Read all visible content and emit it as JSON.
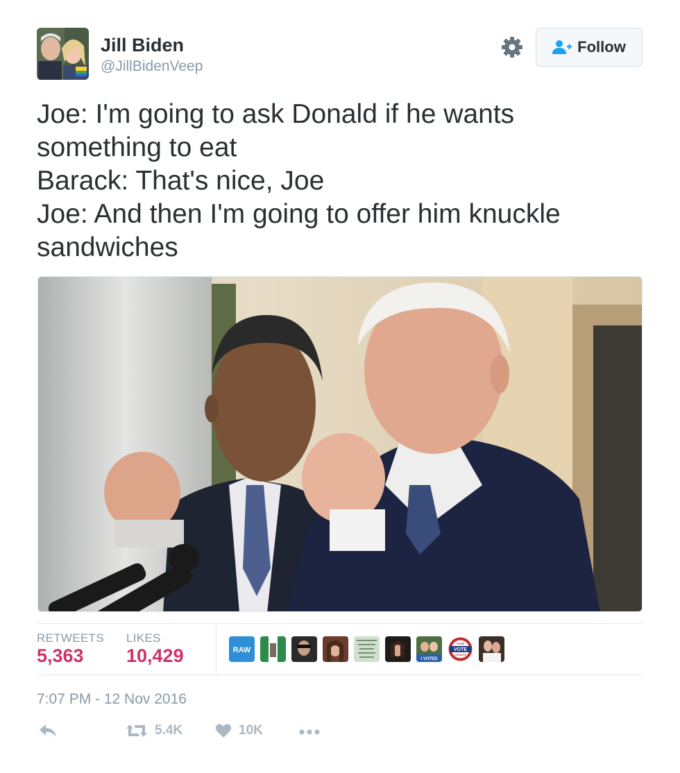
{
  "user": {
    "display_name": "Jill Biden",
    "handle": "@JillBidenVeep"
  },
  "header": {
    "follow_label": "Follow",
    "settings_icon": "gear-icon",
    "follow_icon": "add-user-icon"
  },
  "tweet": {
    "lines": [
      "Joe: I'm going to ask Donald if he wants",
      "something to eat",
      "Barack: That's nice, Joe",
      "Joe: And then I'm going to offer him knuckle",
      "sandwiches"
    ]
  },
  "stats": {
    "retweets_label": "RETWEETS",
    "retweets_value": "5,363",
    "likes_label": "LIKES",
    "likes_value": "10,429"
  },
  "liker_avatars": {
    "raw_badge": "RAW",
    "vote_badge_top": "YOUR",
    "vote_badge_main": "VOTE",
    "vote_badge_bottom": "COUNTS",
    "voted_badge": "I VOTED"
  },
  "timestamp": "7:07 PM - 12 Nov 2016",
  "actions": {
    "reply_icon": "reply-icon",
    "retweet_icon": "retweet-icon",
    "retweet_count": "5.4K",
    "like_icon": "heart-icon",
    "like_count": "10K",
    "more_icon": "more-icon"
  },
  "colors": {
    "stat_value": "#cc3366",
    "muted": "#8899a6",
    "accent": "#1da1f2",
    "text": "#292f33"
  }
}
